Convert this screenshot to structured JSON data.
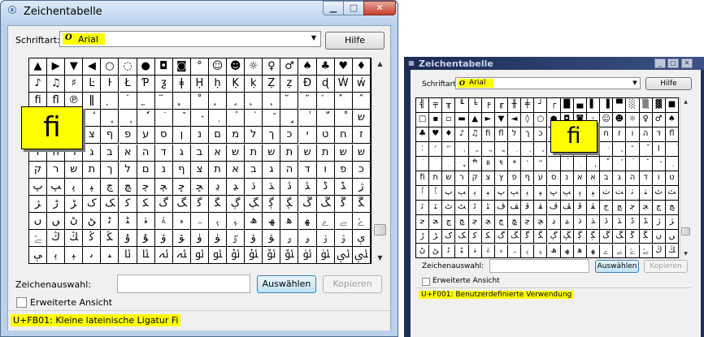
{
  "left": {
    "title": "Zeichentabelle",
    "font_label": "Schriftart:",
    "font_icon": "O",
    "font_value": "Arial",
    "help": "Hilfe",
    "glyph_rows": [
      [
        "▲",
        "▶",
        "▼",
        "◀",
        "○",
        "◌",
        "●",
        "◘",
        "◙",
        "°",
        "☺",
        "☻",
        "☼",
        "♀",
        "♂",
        "♠",
        "♣",
        "♥",
        "♦"
      ],
      [
        "♪",
        "♫",
        "♯",
        "Ŀ",
        "ŀ",
        "Ł",
        "Ƥ",
        "ƺ",
        "ǂ",
        "Ḥ",
        "ḥ",
        "Ḳ",
        "ḳ",
        "Ẓ",
        "ẓ",
        "Ɖ",
        "ɖ",
        "Ẃ",
        "ẃ"
      ],
      [
        "ﬁ",
        "ﬂ",
        "℗",
        "ǁ",
        "̣",
        "˙",
        "̤",
        "̈",
        "̥",
        "˚",
        "̧",
        "¸",
        "̨",
        "˛",
        "̆",
        "˘",
        "̇",
        "̂",
        "ˆ"
      ],
      [
        "ٍ",
        "ٌ",
        "ٓ",
        "ٔ",
        "ٕ",
        "ٖ",
        "ٗ",
        "ٙ",
        "ٚ",
        "ٛ",
        "ٜ",
        "ٝ",
        "ٞ",
        "٘",
        "ٟ",
        "ٰ",
        "ّ",
        "ْ",
        "ש"
      ],
      [
        "ר",
        "ק",
        "ץ",
        "צ",
        "ף",
        "פ",
        "ע",
        "ס",
        "ן",
        "נ",
        "ם",
        "מ",
        "ל",
        "ך",
        "כ",
        "י",
        "ט",
        "ח",
        "ז"
      ],
      [
        "ו",
        "ה",
        "ד",
        "ג",
        "ב",
        "א",
        "ה",
        "ד",
        "ג",
        "ב",
        "א",
        "ש",
        "ת",
        "ש",
        "ת",
        "ש",
        "ת",
        "ש",
        "ש"
      ],
      [
        "ק",
        "ר",
        "ש",
        "ת",
        "ך",
        "ל",
        "ם",
        "נ",
        "ף",
        "צ",
        "ת",
        "א",
        "ב",
        "ג",
        "ה",
        "ד",
        "ו",
        "פ",
        "כ"
      ],
      [
        "ﭖ",
        "ﭗ",
        "ﭘ",
        "ﭙ",
        "ﭺ",
        "ﭻ",
        "ﭼ",
        "ﭽ",
        "ﮀ",
        "ﮁ",
        "ﮂ",
        "ﮃ",
        "ﮄ",
        "ﮅ",
        "ﮆ",
        "ﮇ",
        "ﮈ",
        "ﮉ",
        "ﮊ"
      ],
      [
        "ﮋ",
        "ﮌ",
        "ﮍ",
        "ﮎ",
        "ﮏ",
        "ﮐ",
        "ﮑ",
        "ﮒ",
        "ﮓ",
        "ﮔ",
        "ﮕ",
        "ﮖ",
        "ﮗ",
        "ﮘ",
        "ﮙ",
        "ﮚ",
        "ﮛ",
        "ﮜ",
        "ﮝ"
      ],
      [
        "ﮞ",
        "ﮟ",
        "ﮠ",
        "ﮡ",
        "ﮢ",
        "ﮣ",
        "ﮤ",
        "ﮥ",
        "ﮦ",
        "ﮧ",
        "ﮨ",
        "ﮩ",
        "ﮪ",
        "ﮫ",
        "ﮬ",
        "ﮭ",
        "ﮮ",
        "ﮯ",
        "ﮰ"
      ],
      [
        "ﮱ",
        "ﯓ",
        "ﯔ",
        "ﯕ",
        "ﯖ",
        "ﯗ",
        "ﯘ",
        "ﯙ",
        "ﯚ",
        "ﯛ",
        "ﯜ",
        "ﯝ",
        "ﯞ",
        "ﯟ",
        "ﯠ",
        "ﯡ",
        "ﯢ",
        "ﯣ",
        "ﯤ"
      ],
      [
        "ﯥ",
        "ﯦ",
        "ﯧ",
        "ﯨ",
        "ﯩ",
        "ﯪ",
        "ﯫ",
        "ﯬ",
        "ﯭ",
        "ﯮ",
        "ﯯ",
        "ﯰ",
        "ﯱ",
        "ﯲ",
        "ﯳ",
        "ﯴ",
        "ﯵ",
        "ﯶ",
        "ﯷ"
      ]
    ],
    "zoom_glyph": "fi",
    "selection_label": "Zeichenauswahl:",
    "select_btn": "Auswählen",
    "copy_btn": "Kopieren",
    "advanced_label": "Erweiterte Ansicht",
    "status": "U+FB01: Kleine lateinische Ligatur Fi"
  },
  "right": {
    "title": "Zeichentabelle",
    "font_label": "Schriftart:",
    "font_icon": "O",
    "font_value": "Arial",
    "help": "Hilfe",
    "glyph_rows": [
      [
        "╣",
        "╤",
        "╥",
        "╙",
        "╘",
        "╒",
        "╓",
        "╫",
        "╪",
        "┘",
        "┌",
        "█",
        "▄",
        "▌",
        "▐",
        "▀",
        "░",
        "▒",
        "▓",
        "■"
      ],
      [
        "□",
        "▪",
        "▫",
        "▬",
        "▲",
        "►",
        "▼",
        "◄",
        "◊",
        "○",
        "●",
        "◘",
        "◙",
        "◦",
        "☺",
        "☻",
        "☼",
        "♀",
        "♂",
        "♠"
      ],
      [
        "♣",
        "♥",
        "♦",
        "♪",
        "♫",
        "ﬁ",
        "ﬂ",
        "ל",
        "ך",
        "כ",
        "ס",
        "ע",
        "י",
        "ט",
        "ח",
        "ז",
        "ו",
        "ה",
        "ד",
        "ﬂ"
      ],
      [
        "׃",
        "׳",
        "״",
        "ְ",
        "ֱ",
        "ֲ",
        "ֳ",
        "ִ",
        "ֵ",
        "ֶ",
        "ַ",
        "ָ",
        "ֹ",
        "ֻ",
        "ּ",
        "ֽ",
        "־",
        "ֿ",
        "׀",
        "ׁ"
      ],
      [
        "ׂ",
        "ׄ",
        "ׅ",
        "ׇ",
        "ׯ",
        "װ",
        "ױ",
        "ײ",
        "׳",
        "״",
        "ؘ",
        "ؙ",
        "ؚ",
        "ٖ",
        "ٗ",
        "٘",
        "ٙ",
        "ٚ",
        "ٛ",
        "ٜ"
      ],
      [
        "ﬁ",
        "ת",
        "ש",
        "ר",
        "ק",
        "צ",
        "ץ",
        "פ",
        "ף",
        "ע",
        "ס",
        "נ",
        "א",
        "א",
        "ב",
        "ג",
        "ה",
        "ד",
        "ו",
        "ט"
      ],
      [
        "ﭐ",
        "ﭑ",
        "ﭒ",
        "ﭓ",
        "ﭔ",
        "ﭕ",
        "ﭖ",
        "ﭗ",
        "ﭘ",
        "ﭙ",
        "ﭚ",
        "ﭛ",
        "ﭜ",
        "ﭝ",
        "ﭞ",
        "ﭟ",
        "ﭠ",
        "ﭡ",
        "ﭢ",
        "ﭣ"
      ],
      [
        "ﭤ",
        "ﭥ",
        "ﭦ",
        "ﭧ",
        "ﭨ",
        "ﭩ",
        "ﭪ",
        "ﭫ",
        "ﭬ",
        "ﭭ",
        "ﭮ",
        "ﭯ",
        "ﭰ",
        "ﭱ",
        "ﭲ",
        "ﭳ",
        "ﭴ",
        "ﭵ",
        "ﭶ",
        "ﭷ"
      ],
      [
        "ﭸ",
        "ﭹ",
        "ﭺ",
        "ﭻ",
        "ﭼ",
        "ﭽ",
        "ﭾ",
        "ﭿ",
        "ﮀ",
        "ﮁ",
        "ﮂ",
        "ﮃ",
        "ﮄ",
        "ﮅ",
        "ﮆ",
        "ﮇ",
        "ﮈ",
        "ﮉ",
        "ﮊ",
        "ﮋ"
      ],
      [
        "ﮌ",
        "ﮍ",
        "ﮎ",
        "ﮏ",
        "ﮐ",
        "ﮑ",
        "ﮒ",
        "ﮓ",
        "ﮔ",
        "ﮕ",
        "ﮖ",
        "ﮗ",
        "ﮘ",
        "ﮙ",
        "ﮚ",
        "ﮛ",
        "ﮜ",
        "ﮝ",
        "ﮞ",
        "ﮟ"
      ],
      [
        "ﮠ",
        "ﮡ",
        "ﮢ",
        "ﮣ",
        "ﮤ",
        "ﮥ",
        "ﮦ",
        "ﮧ",
        "ﮨ",
        "ﮩ",
        "ﮪ",
        "ﮫ",
        "ﮬ",
        "ﮭ",
        "ﮮ",
        "ﮯ",
        "ﮰ",
        "ﮱ",
        "ﯓ",
        "ﯔ"
      ]
    ],
    "zoom_glyph": "fi",
    "selection_label": "Zeichenauswahl:",
    "select_btn": "Auswählen",
    "copy_btn": "Kopieren",
    "advanced_label": "Erweiterte Ansicht",
    "status": "U+F001: Benutzerdefinierte Verwendung"
  },
  "icons": {
    "minimize": "minimize-icon",
    "maximize": "maximize-icon",
    "close": "close-icon",
    "dropdown": "chevron-down-icon"
  },
  "colors": {
    "highlight": "#ffff00",
    "aero_title": "#bcd3ec",
    "classic_title": "#1e2f57"
  }
}
